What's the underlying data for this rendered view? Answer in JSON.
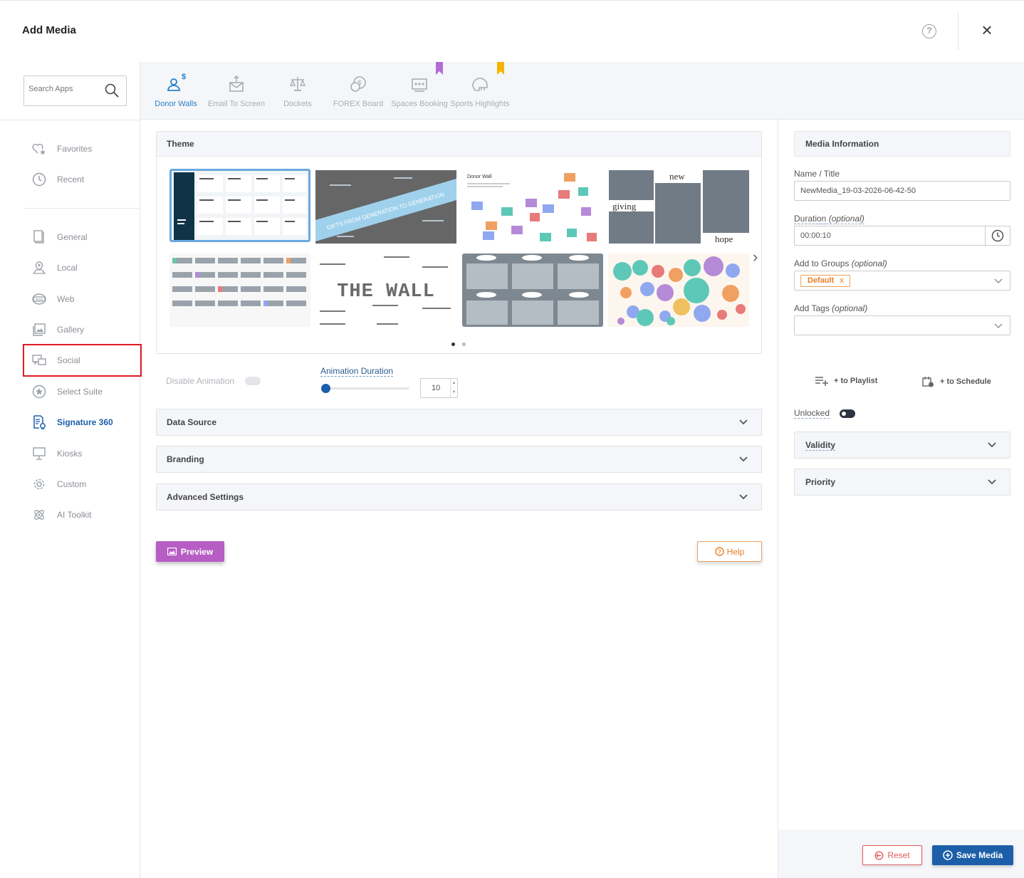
{
  "header": {
    "title": "Add Media",
    "help_icon": "question-circle-icon",
    "close_icon": "close-icon"
  },
  "search": {
    "placeholder": "Search Apps"
  },
  "sidebar": {
    "items": [
      {
        "label": "Favorites",
        "icon": "heart-star-icon"
      },
      {
        "label": "Recent",
        "icon": "clock-icon"
      },
      {
        "label": "General",
        "icon": "document-icon"
      },
      {
        "label": "Local",
        "icon": "map-pin-icon"
      },
      {
        "label": "Web",
        "icon": "globe-icon"
      },
      {
        "label": "Gallery",
        "icon": "image-gallery-icon"
      },
      {
        "label": "Social",
        "icon": "chat-icon"
      },
      {
        "label": "Select Suite",
        "icon": "star-circle-icon"
      },
      {
        "label": "Signature 360",
        "icon": "signature-doc-icon"
      },
      {
        "label": "Kiosks",
        "icon": "kiosk-icon"
      },
      {
        "label": "Custom",
        "icon": "gear-icon"
      },
      {
        "label": "AI Toolkit",
        "icon": "ai-icon"
      }
    ],
    "active": "Signature 360"
  },
  "apps": [
    {
      "label": "Donor Walls",
      "icon": "donor-icon"
    },
    {
      "label": "Email To Screen",
      "icon": "email-icon"
    },
    {
      "label": "Dockets",
      "icon": "scales-icon"
    },
    {
      "label": "FOREX Board",
      "icon": "currency-icon"
    },
    {
      "label": "Spaces Booking",
      "icon": "room-booking-icon"
    },
    {
      "label": "Sports Highlights",
      "icon": "helmet-icon"
    }
  ],
  "theme": {
    "title": "Theme",
    "thumbs": {
      "t2_banner": "GIFTS FROM GENERATION TO GENERATION",
      "t3_title": "Donor Wall",
      "t4_words": [
        "new",
        "giving",
        "hope"
      ],
      "t6_title": "THE WALL"
    },
    "pages": 2,
    "current_page": 1
  },
  "animation": {
    "disable_label": "Disable Animation",
    "duration_label": "Animation Duration",
    "duration_value": "10",
    "slider_fraction": 0.0
  },
  "sections": {
    "data_source": "Data Source",
    "branding": "Branding",
    "advanced": "Advanced Settings"
  },
  "buttons": {
    "preview": "Preview",
    "help": "Help",
    "reset": "Reset",
    "save": "Save Media"
  },
  "media_info": {
    "title": "Media Information",
    "name_label": "Name / Title",
    "name_value": "NewMedia_19-03-2026-06-42-50",
    "duration_label": "Duration",
    "duration_opt": "(optional)",
    "duration_value": "00:00:10",
    "groups_label": "Add to Groups",
    "groups_opt": "(optional)",
    "group_chip": "Default",
    "group_chip_remove": "x",
    "tags_label": "Add Tags",
    "tags_opt": "(optional)",
    "to_playlist": "+ to Playlist",
    "to_schedule": "+ to Schedule",
    "unlocked_label": "Unlocked",
    "validity": "Validity",
    "priority": "Priority"
  },
  "colors": {
    "primary": "#1c5fa8",
    "preview": "#b65ec3",
    "help": "#e97d23",
    "reset": "#e15c5c",
    "highlight": "#e01b24"
  }
}
